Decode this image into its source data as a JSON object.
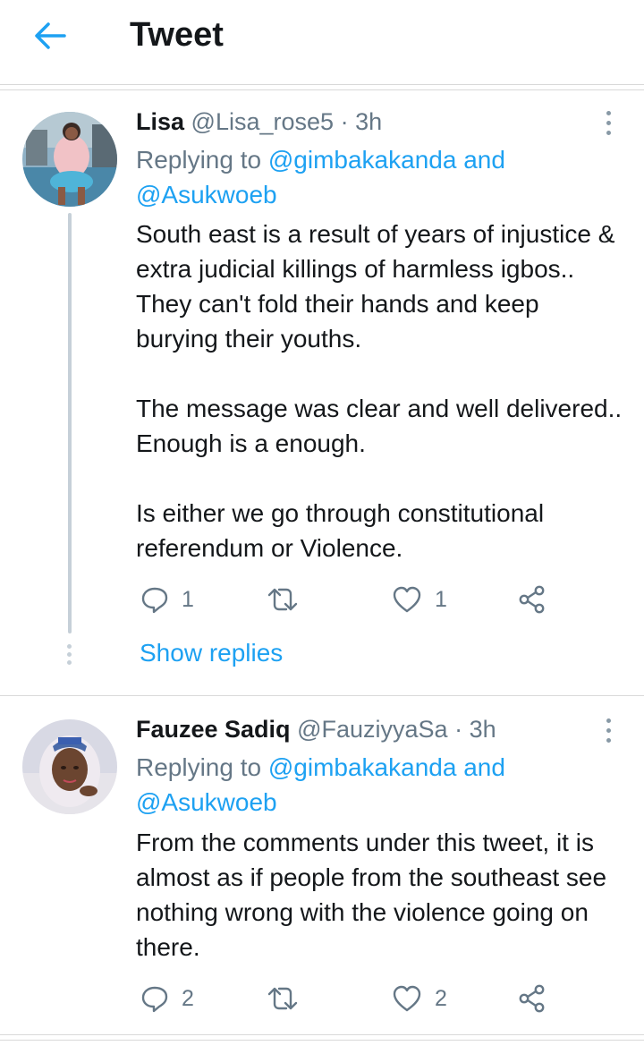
{
  "header": {
    "title": "Tweet",
    "back_icon": "arrow-left-icon",
    "accent": "#1da1f2"
  },
  "tweets": [
    {
      "name": "Lisa",
      "handle": "@Lisa_rose5",
      "dot": "·",
      "time": "3h",
      "replying_prefix": "Replying to ",
      "mention1": "@gimbakakanda",
      "and": " and",
      "mention2": "@Asukwoeb",
      "paragraphs": [
        "South east is a result of years of injustice & extra judicial killings of harmless igbos.. They can't fold their hands and keep burying their youths.",
        "The message was clear and well delivered.. Enough is a enough.",
        "Is either we go through constitutional referendum or Violence."
      ],
      "reply_count": "1",
      "like_count": "1",
      "show_replies": "Show replies"
    },
    {
      "name": "Fauzee Sadiq",
      "handle": "@FauziyyaSa",
      "dot": "·",
      "time": "3h",
      "replying_prefix": "Replying to ",
      "mention1": "@gimbakakanda",
      "and": " and",
      "mention2": "@Asukwoeb",
      "paragraphs": [
        "From the comments under this tweet, it is almost as if people from the southeast see nothing wrong with the violence going on there."
      ],
      "reply_count": "2",
      "like_count": "2"
    }
  ]
}
